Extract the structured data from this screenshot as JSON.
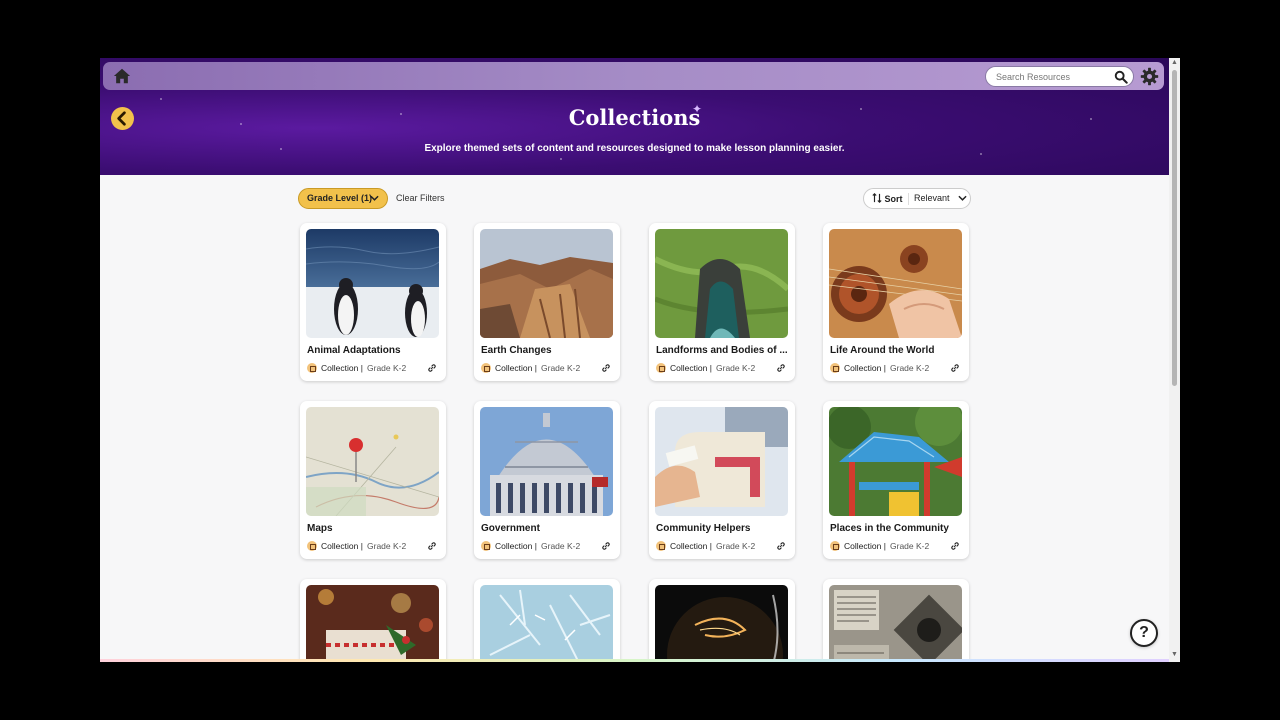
{
  "header": {
    "search_placeholder": "Search Resources",
    "title": "Collections",
    "subtitle": "Explore themed sets of content and resources designed to make lesson planning easier."
  },
  "filters": {
    "grade_level": "Grade Level (1)",
    "clear": "Clear Filters",
    "sort_label": "Sort",
    "sort_value": "Relevant"
  },
  "cards": [
    {
      "title": "Animal Adaptations",
      "type": "Collection",
      "grade": "Grade K-2",
      "image": "penguins-photo"
    },
    {
      "title": "Earth Changes",
      "type": "Collection",
      "grade": "Grade K-2",
      "image": "canyon-cliff-photo"
    },
    {
      "title": "Landforms and Bodies of ...",
      "type": "Collection",
      "grade": "Grade K-2",
      "image": "aerial-cove-photo"
    },
    {
      "title": "Life Around the World",
      "type": "Collection",
      "grade": "Grade K-2",
      "image": "oud-instrument-photo"
    },
    {
      "title": "Maps",
      "type": "Collection",
      "grade": "Grade K-2",
      "image": "map-pins-photo"
    },
    {
      "title": "Government",
      "type": "Collection",
      "grade": "Grade K-2",
      "image": "capitol-dome-photo"
    },
    {
      "title": "Community Helpers",
      "type": "Collection",
      "grade": "Grade K-2",
      "image": "mailbox-photo"
    },
    {
      "title": "Places in the Community",
      "type": "Collection",
      "grade": "Grade K-2",
      "image": "playground-photo"
    },
    {
      "title": "",
      "type": "",
      "grade": "",
      "image": "holiday-gift-photo"
    },
    {
      "title": "",
      "type": "",
      "grade": "",
      "image": "frost-crystals-photo"
    },
    {
      "title": "",
      "type": "",
      "grade": "",
      "image": "light-bulb-photo"
    },
    {
      "title": "",
      "type": "",
      "grade": "",
      "image": "vintage-newspaper-photo"
    }
  ],
  "help": {
    "label": "?"
  },
  "colors": {
    "hero_purple": "#3b0d72",
    "accent_yellow": "#f2c14b",
    "page_bg": "#f7f7f8"
  }
}
